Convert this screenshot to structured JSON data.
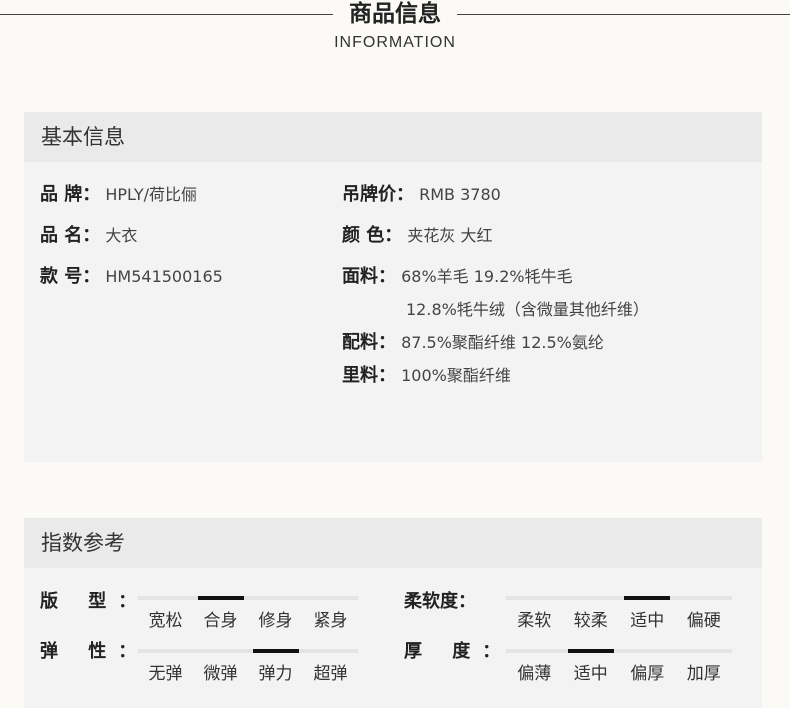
{
  "header": {
    "title": "商品信息",
    "subtitle": "INFORMATION"
  },
  "basic": {
    "title": "基本信息",
    "brand_label": "品 牌：",
    "brand_value": "HPLY/荷比俪",
    "name_label": "品 名：",
    "name_value": "大衣",
    "style_label": "款 号：",
    "style_value": "HM541500165",
    "price_label": "吊牌价：",
    "price_value": "RMB 3780",
    "color_label": "颜 色：",
    "color_value": "夹花灰  大红",
    "fabric_label": "面料：",
    "fabric_value_1": "68%羊毛    19.2%牦牛毛",
    "fabric_value_2": "12.8%牦牛绒（含微量其他纤维）",
    "accessory_label": "配料：",
    "accessory_value": "87.5%聚酯纤维     12.5%氨纶",
    "lining_label": "里料：",
    "lining_value": "100%聚酯纤维"
  },
  "index": {
    "title": "指数参考",
    "fit": {
      "label": "版 型：",
      "options": [
        "宽松",
        "合身",
        "修身",
        "紧身"
      ],
      "selected": "合身"
    },
    "softness": {
      "label": "柔软度：",
      "options": [
        "柔软",
        "较柔",
        "适中",
        "偏硬"
      ],
      "selected": "适中"
    },
    "elasticity": {
      "label": "弹 性：",
      "options": [
        "无弹",
        "微弹",
        "弹力",
        "超弹"
      ],
      "selected": "弹力"
    },
    "thickness": {
      "label": "厚 度：",
      "options": [
        "偏薄",
        "适中",
        "偏厚",
        "加厚"
      ],
      "selected": "适中"
    }
  }
}
